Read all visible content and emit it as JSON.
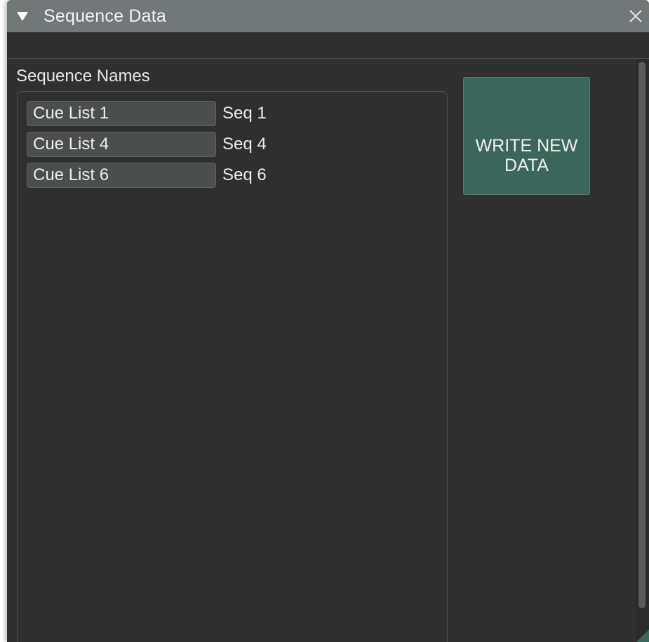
{
  "window": {
    "title": "Sequence Data",
    "collapse_icon": "triangle-down-icon",
    "close_icon": "close-icon"
  },
  "panel": {
    "section_label": "Sequence Names",
    "rows": [
      {
        "name": "Cue List 1",
        "seq": "Seq 1"
      },
      {
        "name": "Cue List 4",
        "seq": "Seq 4"
      },
      {
        "name": "Cue List 6",
        "seq": "Seq 6"
      }
    ]
  },
  "actions": {
    "write_button_label": "WRITE NEW DATA"
  },
  "colors": {
    "titlebar": "#717877",
    "background": "#303030",
    "accent_button": "#3a6759",
    "input_field": "#4a4f4e",
    "text": "#ececec"
  }
}
